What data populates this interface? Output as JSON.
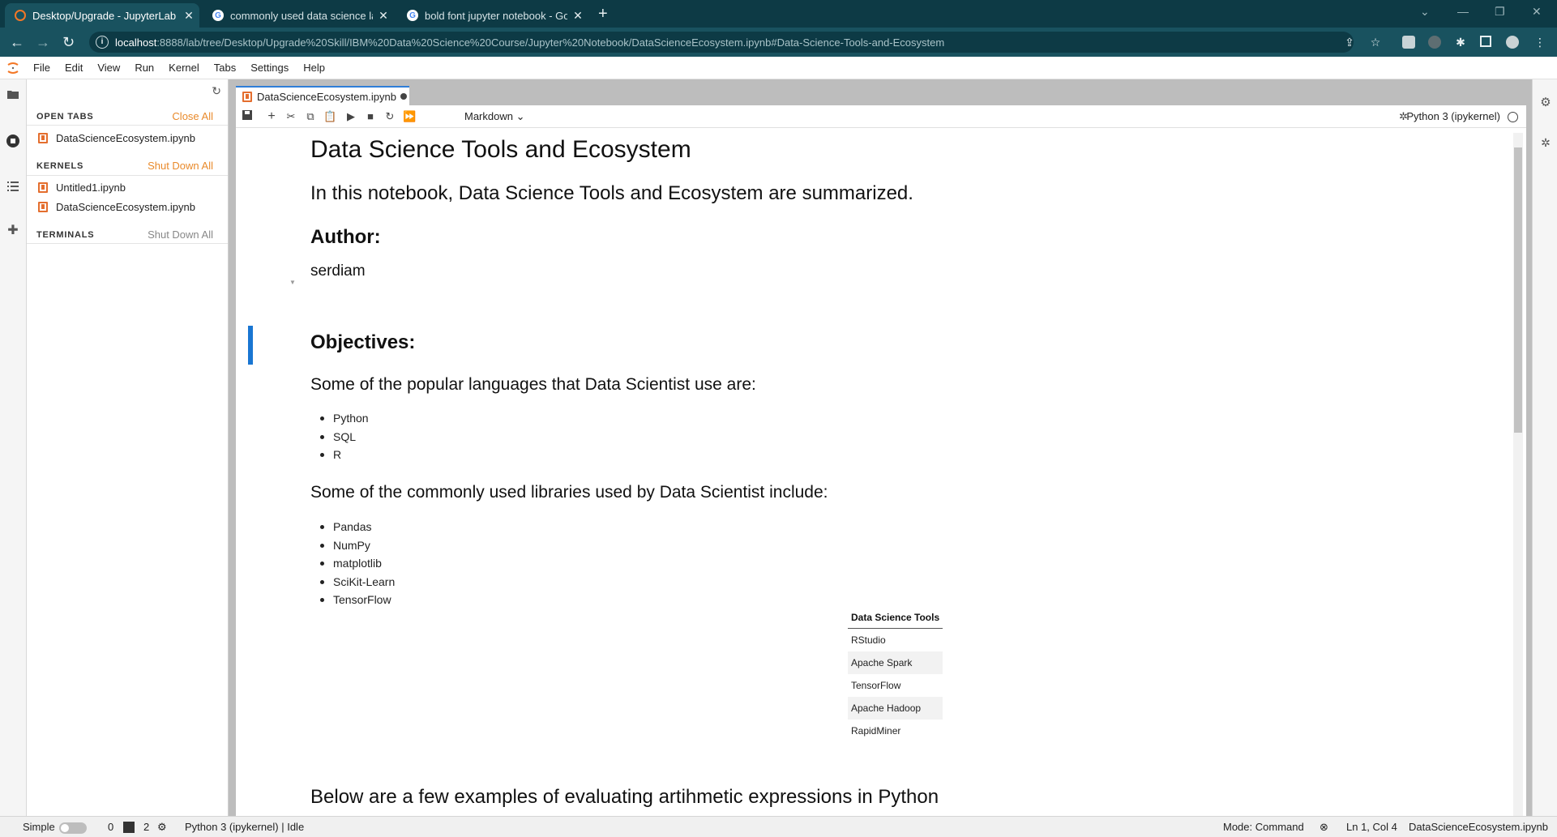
{
  "browser": {
    "tabs": [
      {
        "title": "Desktop/Upgrade - JupyterLab",
        "active": true
      },
      {
        "title": "commonly used data science lan",
        "active": false
      },
      {
        "title": "bold font jupyter notebook - Go",
        "active": false
      }
    ],
    "url_host": "localhost",
    "url_rest": ":8888/lab/tree/Desktop/Upgrade%20Skill/IBM%20Data%20Science%20Course/Jupyter%20Notebook/DataScienceEcosystem.ipynb#Data-Science-Tools-and-Ecosystem"
  },
  "menu": [
    "File",
    "Edit",
    "View",
    "Run",
    "Kernel",
    "Tabs",
    "Settings",
    "Help"
  ],
  "sidebar": {
    "open_tabs_label": "OPEN TABS",
    "close_all": "Close All",
    "open_tabs": [
      "DataScienceEcosystem.ipynb"
    ],
    "kernels_label": "KERNELS",
    "shut_down_all": "Shut Down All",
    "kernels": [
      "Untitled1.ipynb",
      "DataScienceEcosystem.ipynb"
    ],
    "terminals_label": "TERMINALS",
    "terminals_shut_down_all": "Shut Down All"
  },
  "doc_tab": {
    "title": "DataScienceEcosystem.ipynb"
  },
  "toolbar": {
    "cell_type": "Markdown",
    "kernel": "Python 3 (ipykernel)"
  },
  "notebook": {
    "title": "Data Science Tools and Ecosystem",
    "intro": "In this notebook, Data Science Tools and Ecosystem are summarized.",
    "author_heading": "Author:",
    "author": "serdiam",
    "objectives_heading": "Objectives:",
    "languages_heading": "Some of the popular languages that Data Scientist use are:",
    "languages": [
      "Python",
      "SQL",
      "R"
    ],
    "libraries_heading": "Some of the commonly used libraries used by Data Scientist include:",
    "libraries": [
      "Pandas",
      "NumPy",
      "matplotlib",
      "SciKit-Learn",
      "TensorFlow"
    ],
    "tools_table_header": "Data Science Tools",
    "tools": [
      "RStudio",
      "Apache Spark",
      "TensorFlow",
      "Apache Hadoop",
      "RapidMiner"
    ],
    "arith_heading": "Below are a few examples of evaluating artihmetic expressions in Python"
  },
  "status": {
    "mode_label": "Simple",
    "terminals_count": "0",
    "kernels_count": "2",
    "kernel_status": "Python 3 (ipykernel) | Idle",
    "mode": "Mode: Command",
    "position": "Ln 1, Col 4",
    "filename": "DataScienceEcosystem.ipynb"
  },
  "colors": {
    "accent": "#e98a2b",
    "active_cell": "#1976d2",
    "browser_bg": "#0d3a45"
  }
}
